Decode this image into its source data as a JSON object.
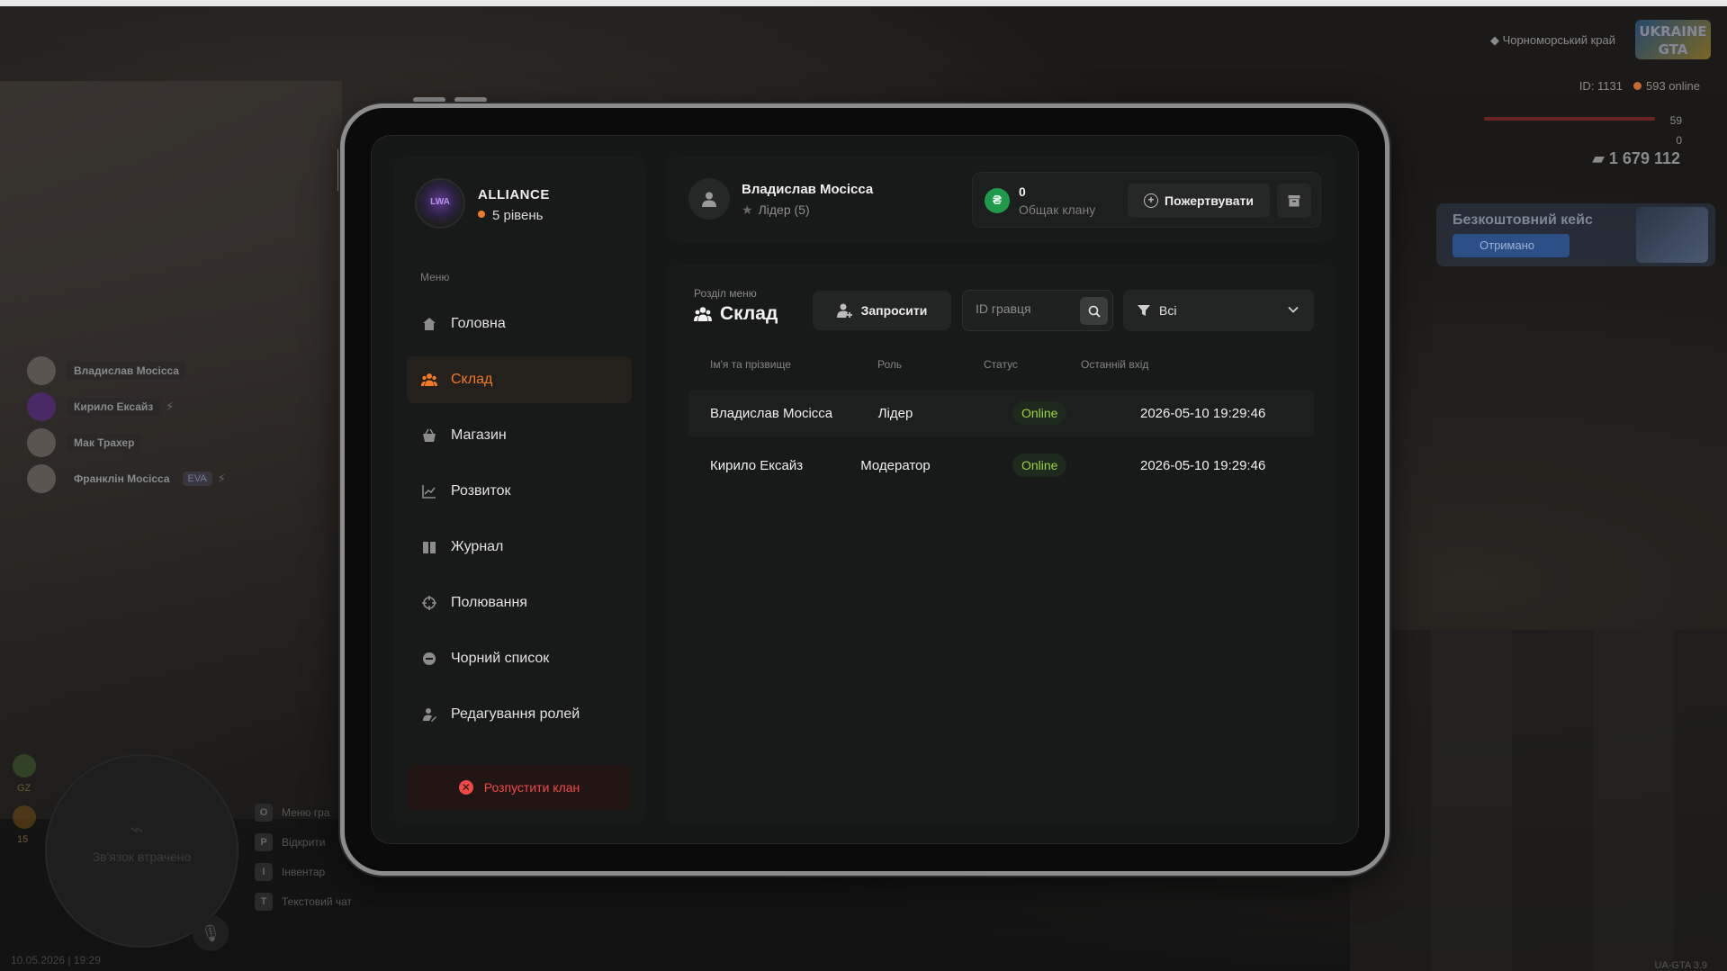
{
  "hud": {
    "region": "Чорноморський край",
    "logo": "UKRAINE GTA",
    "server_id": "ID: 1131",
    "online": "593 online",
    "health": "59",
    "armor": "0",
    "money": "1 679 112",
    "free_case_title": "Безкоштовний кейс",
    "free_case_button": "Отримано",
    "datetime": "10.05.2026 | 19:29",
    "version": "UA-GTA 3.9",
    "minimap_text": "Зв'язок втрачено",
    "side_num_1": "GZ",
    "side_num_2": "15",
    "hints": [
      {
        "key": "O",
        "label": "Меню гра"
      },
      {
        "key": "P",
        "label": "Відкрити"
      },
      {
        "key": "I",
        "label": "Інвентар"
      },
      {
        "key": "T",
        "label": "Текстовий чат"
      }
    ],
    "players": [
      {
        "name": "Владислав Мосісса"
      },
      {
        "name": "Кирило Ексайз"
      },
      {
        "name": "Мак Трахер"
      },
      {
        "name": "Франклін Мосісса",
        "tag": "EVA"
      }
    ]
  },
  "clan": {
    "name": "ALLIANCE",
    "level": "5 рівень",
    "avatar_text": "LWA"
  },
  "menu": {
    "caption": "Меню",
    "items": [
      {
        "label": "Головна",
        "icon": "home-icon"
      },
      {
        "label": "Склад",
        "icon": "members-icon"
      },
      {
        "label": "Магазин",
        "icon": "basket-icon"
      },
      {
        "label": "Розвиток",
        "icon": "chart-icon"
      },
      {
        "label": "Журнал",
        "icon": "book-icon"
      },
      {
        "label": "Полювання",
        "icon": "crosshair-icon"
      },
      {
        "label": "Чорний список",
        "icon": "block-icon"
      },
      {
        "label": "Редагування ролей",
        "icon": "user-edit-icon"
      }
    ],
    "active_index": 1,
    "disband_label": "Розпустити клан"
  },
  "user": {
    "name": "Владислав Мосісса",
    "role": "Лідер (5)"
  },
  "bank": {
    "currency_symbol": "₴",
    "value": "0",
    "label": "Общак клану",
    "donate_label": "Пожертвувати"
  },
  "section": {
    "caption": "Розділ меню",
    "title": "Склад",
    "invite_label": "Запросити",
    "search_placeholder": "ID гравця",
    "filter_value": "Всі"
  },
  "table": {
    "headers": [
      "Ім'я та прізвище",
      "Роль",
      "Статус",
      "Останній вхід"
    ],
    "rows": [
      {
        "name": "Владислав Мосісса",
        "role": "Лідер",
        "status": "Online",
        "last": "2026-05-10 19:29:46"
      },
      {
        "name": "Кирило Ексайз",
        "role": "Модератор",
        "status": "Online",
        "last": "2026-05-10 19:29:46"
      }
    ]
  },
  "colors": {
    "accent": "#f07a28",
    "danger": "#ef4a45",
    "online": "#9ad43b",
    "coin": "#1f9a4a"
  }
}
